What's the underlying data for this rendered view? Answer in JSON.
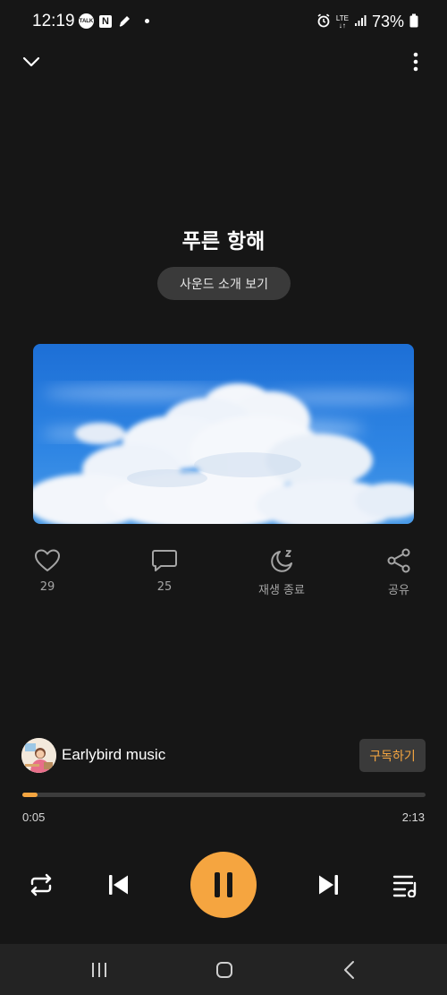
{
  "status_bar": {
    "time": "12:19",
    "talk_label": "TALK",
    "n_label": "N",
    "lte_label": "LTE",
    "battery": "73%"
  },
  "player": {
    "title": "푸른 항해",
    "intro_button": "사운드 소개 보기",
    "actions": {
      "like_count": "29",
      "comment_count": "25",
      "sleep_label": "재생 종료",
      "share_label": "공유"
    },
    "channel": {
      "name": "Earlybird music",
      "subscribe_label": "구독하기"
    },
    "progress": {
      "current": "0:05",
      "total": "2:13",
      "fraction": 0.038
    }
  },
  "colors": {
    "accent": "#f5a540",
    "background": "#161616"
  },
  "icons": [
    "chevron-down-icon",
    "more-vert-icon",
    "heart-icon",
    "comment-icon",
    "sleep-moon-icon",
    "share-icon",
    "repeat-icon",
    "skip-previous-icon",
    "pause-icon",
    "skip-next-icon",
    "playlist-icon",
    "recent-apps-icon",
    "home-icon",
    "back-icon"
  ]
}
